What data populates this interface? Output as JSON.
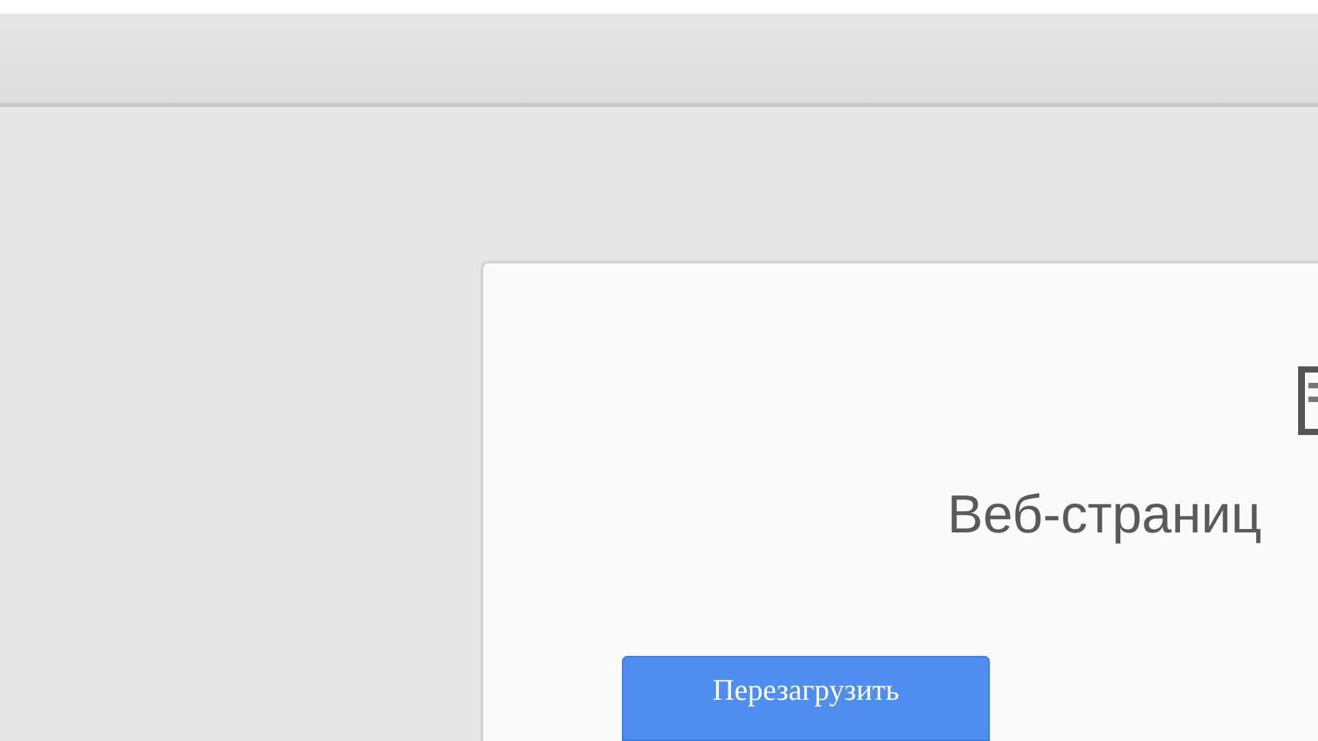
{
  "error_page": {
    "message": "Веб-страниц",
    "reload_button": "Перезагрузить"
  }
}
